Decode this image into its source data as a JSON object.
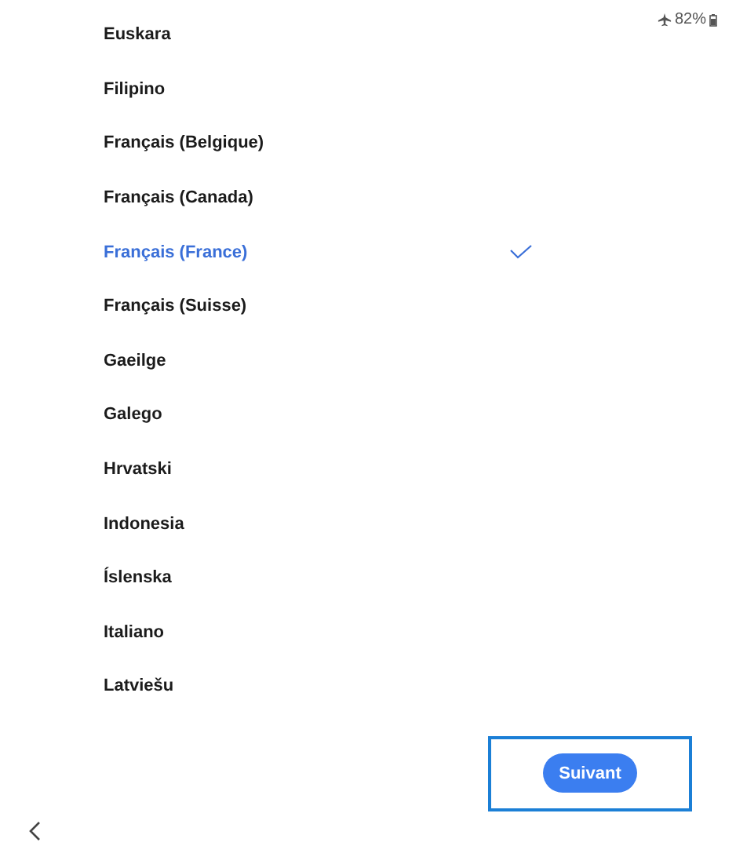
{
  "status_bar": {
    "battery": "82%"
  },
  "languages": [
    {
      "label": "Euskara",
      "selected": false
    },
    {
      "label": "Filipino",
      "selected": false
    },
    {
      "label": "Français (Belgique)",
      "selected": false
    },
    {
      "label": "Français (Canada)",
      "selected": false
    },
    {
      "label": "Français (France)",
      "selected": true
    },
    {
      "label": "Français (Suisse)",
      "selected": false
    },
    {
      "label": "Gaeilge",
      "selected": false
    },
    {
      "label": "Galego",
      "selected": false
    },
    {
      "label": "Hrvatski",
      "selected": false
    },
    {
      "label": "Indonesia",
      "selected": false
    },
    {
      "label": "Íslenska",
      "selected": false
    },
    {
      "label": "Italiano",
      "selected": false
    },
    {
      "label": "Latviešu",
      "selected": false
    }
  ],
  "next_button": {
    "label": "Suivant",
    "highlighted": true
  }
}
